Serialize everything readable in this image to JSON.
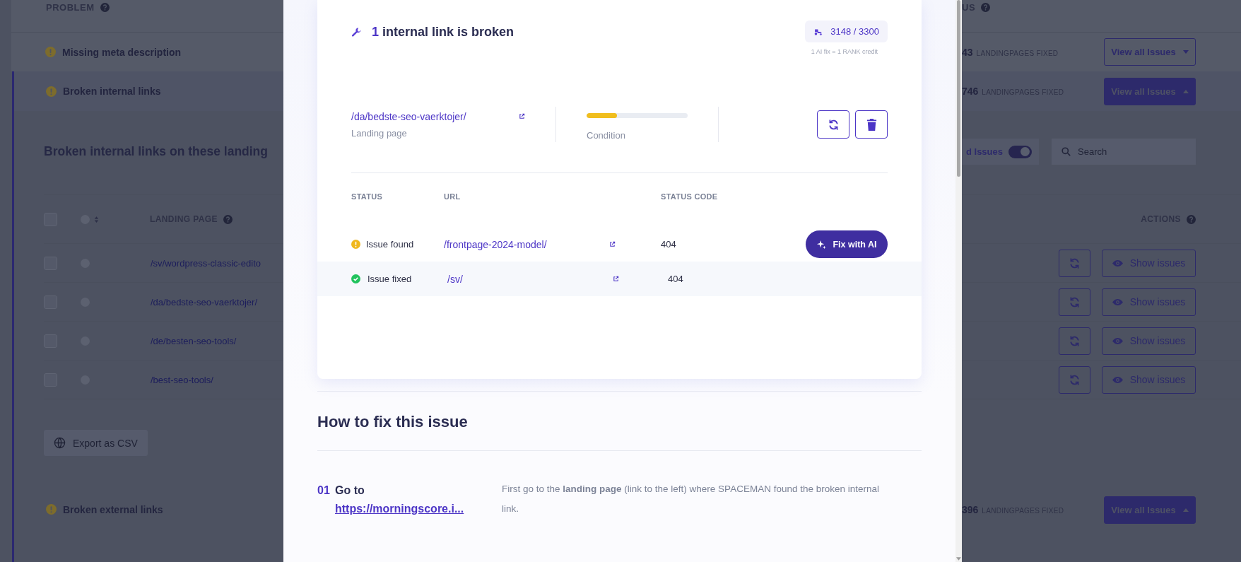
{
  "background": {
    "problem_header": "PROBLEM",
    "status_header": "US",
    "problems": [
      {
        "title": "Missing meta description",
        "fixed_count": "43",
        "fixed_label": "LANDINGPAGES FIXED",
        "button": "View all Issues",
        "expanded": false
      },
      {
        "title": "Broken internal links",
        "fixed_count": "746",
        "fixed_label": "LANDINGPAGES FIXED",
        "button": "View all Issues",
        "expanded": true
      },
      {
        "title": "Broken external links",
        "fixed_count": "396",
        "fixed_label": "LANDINGPAGES FIXED",
        "button": "View all Issues",
        "expanded": true
      }
    ],
    "section": {
      "heading": "Broken internal links on these landing",
      "toggle": {
        "label": "d Issues",
        "on": true
      },
      "search": {
        "placeholder": "Search"
      },
      "select_all_checked": false,
      "columns": [
        "LANDING PAGE",
        "ACTIONS"
      ],
      "rows": [
        {
          "landing_page": "/sv/wordpress-classic-edito",
          "checked": false,
          "action": "Show issues"
        },
        {
          "landing_page": "/da/bedste-seo-vaerktojer/",
          "checked": false,
          "action": "Show issues"
        },
        {
          "landing_page": "/de/besten-seo-tools/",
          "checked": false,
          "action": "Show issues"
        },
        {
          "landing_page": "/best-seo-tools/",
          "checked": false,
          "action": "Show issues"
        }
      ],
      "export_button": "Export as CSV"
    }
  },
  "modal": {
    "count": "1",
    "title": "internal link is broken",
    "credits": "3148 / 3300",
    "credit_note": "1 AI fix = 1 RANK credit",
    "landing_page": {
      "url": "/da/bedste-seo-vaerktojer/",
      "label": "Landing page"
    },
    "condition": {
      "level": 0.3,
      "label": "Condition"
    },
    "columns": [
      "STATUS",
      "URL",
      "STATUS CODE"
    ],
    "links": [
      {
        "kind": "found",
        "status": "Issue found",
        "url": "/frontpage-2024-model/",
        "code": "404",
        "action": "Fix with AI"
      },
      {
        "kind": "fixed",
        "status": "Issue fixed",
        "url": "/sv/",
        "code": "404"
      }
    ],
    "how_to": {
      "heading": "How to fix this issue",
      "steps": [
        {
          "number": "01",
          "title": "Go to",
          "link": "https://morningscore.i...",
          "text": "First go to the **landing page** (link to the left) where SPACEMAN found the broken internal link."
        }
      ]
    }
  }
}
